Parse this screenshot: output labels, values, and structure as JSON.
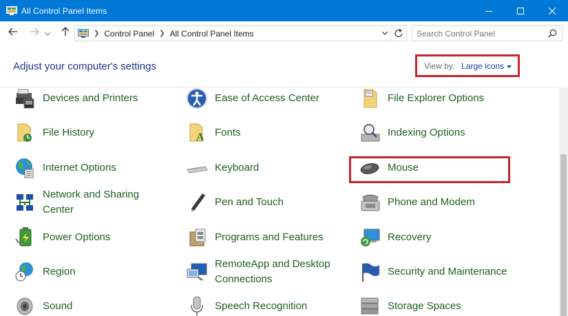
{
  "window": {
    "title": "All Control Panel Items",
    "controls": {
      "minimize": "minimize-icon",
      "maximize": "maximize-icon",
      "close": "close-icon"
    }
  },
  "navigation": {
    "back_icon": "arrow-left-icon",
    "forward_icon": "arrow-right-icon",
    "recent_icon": "chevron-down-icon",
    "up_icon": "arrow-up-icon",
    "breadcrumbs": [
      "Control Panel",
      "All Control Panel Items"
    ],
    "search_placeholder": "Search Control Panel"
  },
  "header": {
    "title": "Adjust your computer's settings",
    "view_by_label": "View by:",
    "view_by_value": "Large icons"
  },
  "colors": {
    "titlebar": "#0078d7",
    "link_green": "#1f5f1f",
    "heading_blue": "#1e3287",
    "highlight_red": "#c4262e"
  },
  "items": [
    {
      "label": "Devices and Printers",
      "icon": "printer-icon"
    },
    {
      "label": "Ease of Access Center",
      "icon": "ease-of-access-icon"
    },
    {
      "label": "File Explorer Options",
      "icon": "folder-options-icon"
    },
    {
      "label": "File History",
      "icon": "file-history-icon"
    },
    {
      "label": "Fonts",
      "icon": "fonts-folder-icon"
    },
    {
      "label": "Indexing Options",
      "icon": "indexing-magnifier-icon"
    },
    {
      "label": "Internet Options",
      "icon": "globe-icon"
    },
    {
      "label": "Keyboard",
      "icon": "keyboard-icon"
    },
    {
      "label": "Mouse",
      "icon": "mouse-icon"
    },
    {
      "label": "Network and Sharing Center",
      "label_line1": "Network and Sharing",
      "label_line2": "Center",
      "icon": "network-icon"
    },
    {
      "label": "Pen and Touch",
      "icon": "pen-icon"
    },
    {
      "label": "Phone and Modem",
      "icon": "phone-modem-icon"
    },
    {
      "label": "Power Options",
      "icon": "battery-icon"
    },
    {
      "label": "Programs and Features",
      "icon": "programs-box-icon"
    },
    {
      "label": "Recovery",
      "icon": "recovery-icon"
    },
    {
      "label": "Region",
      "icon": "region-globe-clock-icon"
    },
    {
      "label": "RemoteApp and Desktop Connections",
      "label_line1": "RemoteApp and Desktop",
      "label_line2": "Connections",
      "icon": "remote-desktop-icon"
    },
    {
      "label": "Security and Maintenance",
      "icon": "flag-icon"
    },
    {
      "label": "Sound",
      "icon": "speaker-icon"
    },
    {
      "label": "Speech Recognition",
      "icon": "microphone-icon"
    },
    {
      "label": "Storage Spaces",
      "icon": "storage-drives-icon"
    }
  ]
}
